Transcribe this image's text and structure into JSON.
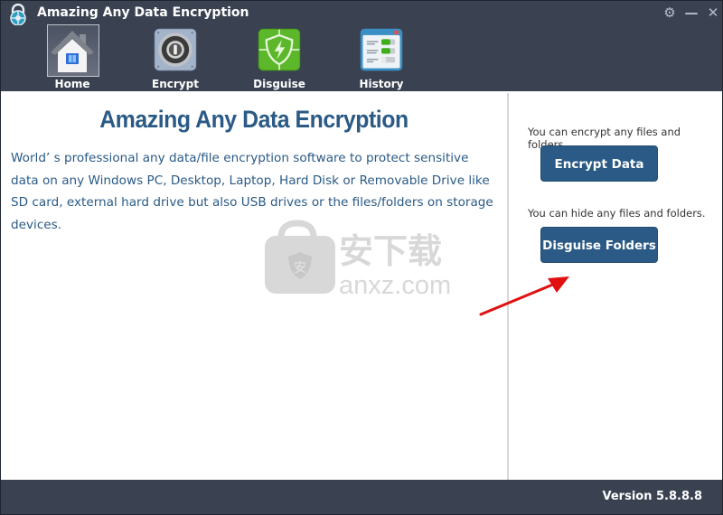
{
  "window": {
    "title": "Amazing Any Data Encryption",
    "controls": {
      "settings_icon": "gear-icon",
      "minimize_icon": "minimize-icon",
      "close_icon": "close-icon",
      "settings_glyph": "⚙",
      "minimize_glyph": "—",
      "close_glyph": "✕"
    }
  },
  "nav": {
    "items": [
      {
        "label": "Home",
        "icon": "home-icon",
        "active": true
      },
      {
        "label": "Encrypt",
        "icon": "safe-lock-icon",
        "active": false
      },
      {
        "label": "Disguise",
        "icon": "shield-lightning-icon",
        "active": false
      },
      {
        "label": "History",
        "icon": "history-list-icon",
        "active": false
      }
    ]
  },
  "main": {
    "title": "Amazing Any Data Encryption",
    "description": "World’ s professional any data/file encryption software to protect sensitive data on any Windows PC, Desktop, Laptop, Hard Disk or Removable Drive like SD card, external hard drive but also USB drives or the files/folders on storage devices."
  },
  "actions": {
    "encrypt_hint": "You can encrypt any files and folders.",
    "encrypt_button": "Encrypt Data",
    "disguise_hint": "You can hide any files and folders.",
    "disguise_button": "Disguise Folders"
  },
  "watermark": {
    "chinese": "安下载",
    "domain": "anxz.com",
    "badge_char": "安"
  },
  "footer": {
    "version": "Version 5.8.8.8"
  },
  "colors": {
    "header_bg": "#3a4252",
    "accent": "#2a5a85",
    "arrow": "#e01010"
  }
}
